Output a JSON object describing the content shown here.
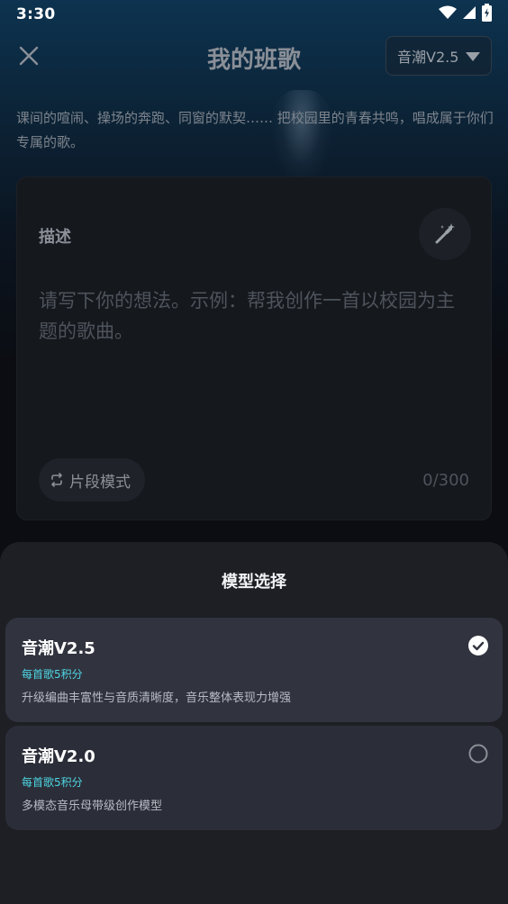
{
  "status_bar": {
    "time": "3:30",
    "icons": [
      "wifi-icon",
      "signal-icon",
      "battery-icon"
    ]
  },
  "header": {
    "title": "我的班歌",
    "close_icon": "close-icon",
    "model_selector": {
      "value": "音潮V2.5",
      "icon": "caret-down-icon"
    }
  },
  "intro_text": "课间的喧闹、操场的奔跑、同窗的默契…… 把校园里的青春共鸣，唱成属于你们专属的歌。",
  "description_card": {
    "label": "描述",
    "magic_icon": "magic-wand-icon",
    "placeholder": "请写下你的想法。示例：帮我创作一首以校园为主题的歌曲。",
    "segment_mode_label": "片段模式",
    "segment_icon": "repeat-icon",
    "counter": "0/300"
  },
  "model_sheet": {
    "title": "模型选择",
    "options": [
      {
        "name": "音潮V2.5",
        "price": "每首歌5积分",
        "description": "升级编曲丰富性与音质清晰度，音乐整体表现力增强",
        "selected": true
      },
      {
        "name": "音潮V2.0",
        "price": "每首歌5积分",
        "description": "多模态音乐母带级创作模型",
        "selected": false
      }
    ]
  },
  "colors": {
    "accent": "#4fd6e4",
    "sheet_bg": "#1d1f24",
    "option_bg": "#2b2e38"
  }
}
